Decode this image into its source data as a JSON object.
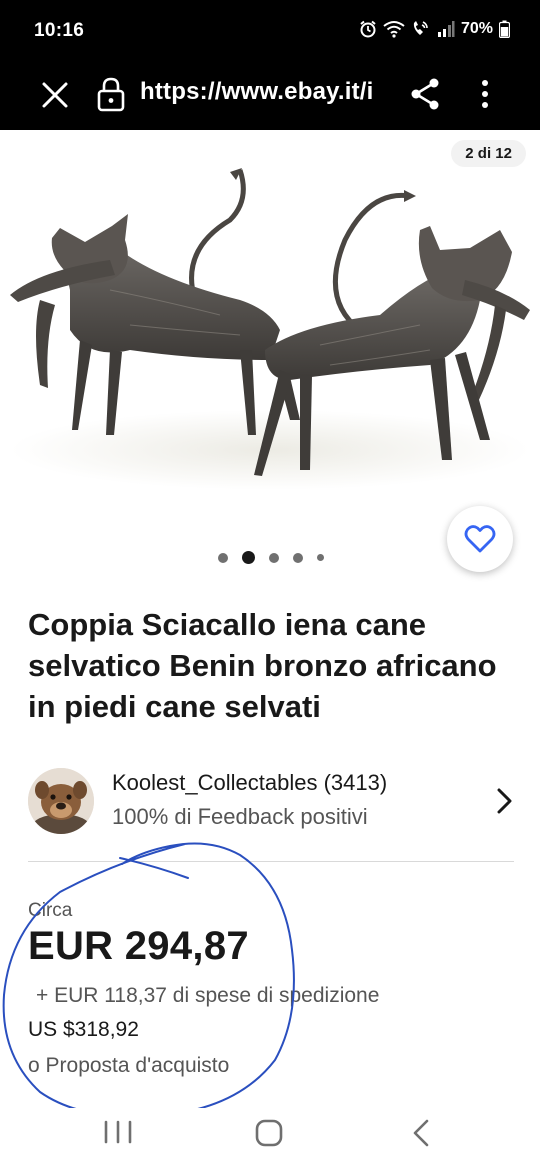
{
  "status_bar": {
    "time": "10:16",
    "battery": "70%",
    "icons": [
      "alarm-icon",
      "wifi-icon",
      "wifi-calling-icon",
      "signal-icon",
      "battery-icon"
    ]
  },
  "browser": {
    "url": "https://www.ebay.it/i",
    "icons": [
      "close-icon",
      "lock-icon",
      "share-icon",
      "more-vert-icon"
    ]
  },
  "gallery": {
    "counter": "2 di 12",
    "total_images": 12,
    "current_image": 2,
    "dots_active_index": 1
  },
  "listing": {
    "title": "Coppia Sciacallo iena cane selvatico Benin bronzo africano in piedi cane selvati"
  },
  "seller": {
    "name": "Koolest_Collectables (3413)",
    "feedback": "100% di Feedback positivi"
  },
  "pricing": {
    "approx_label": "Circa",
    "price": "EUR 294,87",
    "shipping": "+ EUR 118,37 di spese di spedizione",
    "usd_price": "US $318,92",
    "best_offer": "o Proposta d'acquisto"
  },
  "colors": {
    "accent_blue": "#3665f3",
    "annotation_blue": "#2a4fbf",
    "text_primary": "#191919",
    "text_secondary": "#555555",
    "bar_background": "#000000"
  },
  "nav_bar": {
    "icons": [
      "recent-apps-icon",
      "home-icon",
      "back-icon"
    ]
  }
}
